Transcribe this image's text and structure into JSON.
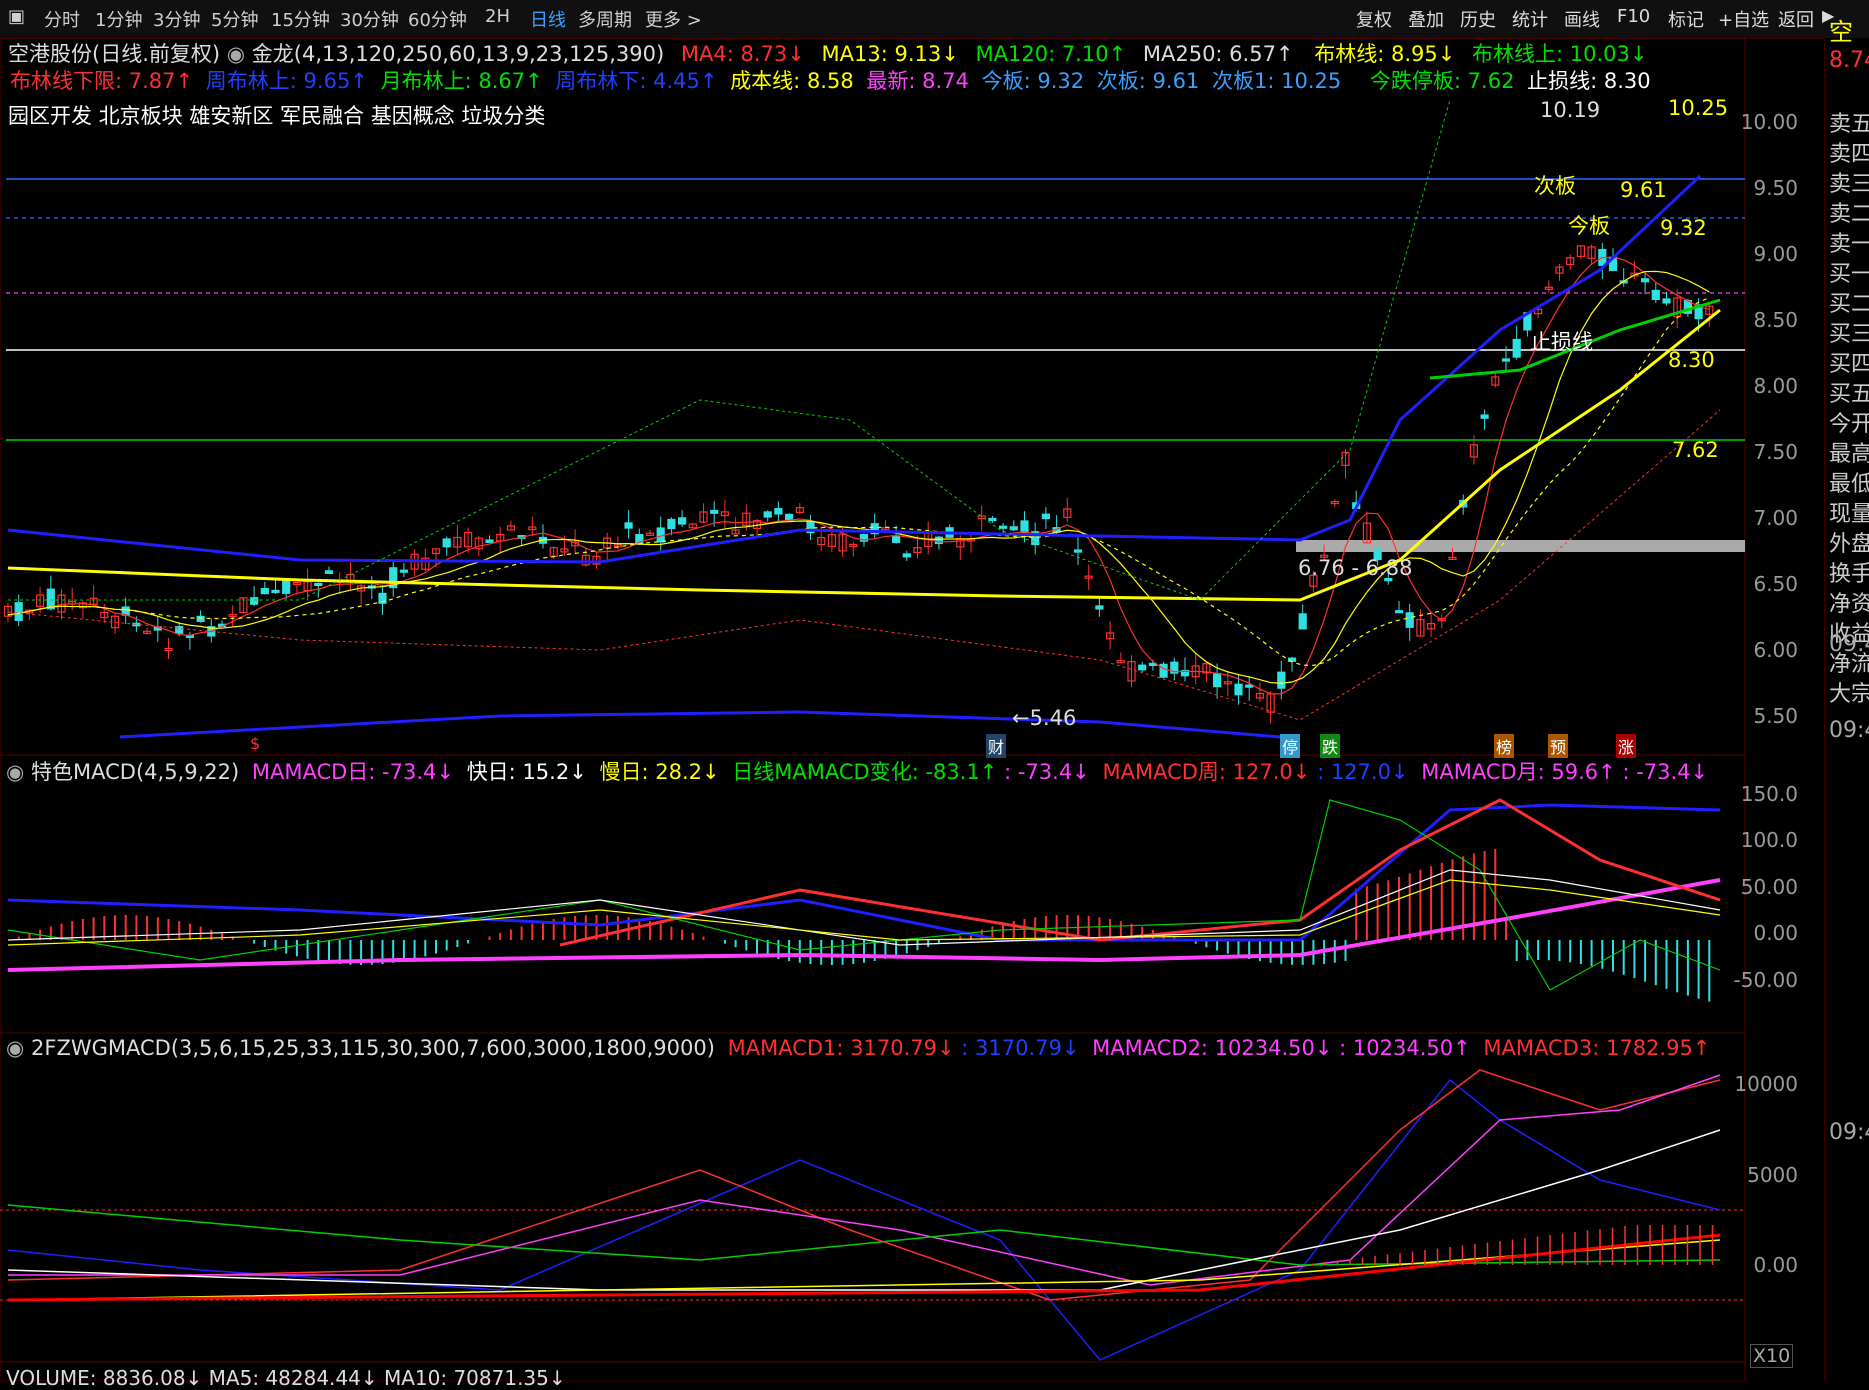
{
  "toolbar": {
    "periods": [
      "分时",
      "1分钟",
      "3分钟",
      "5分钟",
      "15分钟",
      "30分钟",
      "60分钟",
      "2H",
      "日线",
      "多周期",
      "更多 >"
    ],
    "active_period": "日线",
    "right_tools": [
      "复权",
      "叠加",
      "历史",
      "统计",
      "画线",
      "F10",
      "标记",
      "+自选",
      "返回"
    ]
  },
  "header": {
    "stock": "空港股份(日线.前复权)",
    "indicator": "金龙(4,13,120,250,60,13,9,23,125,390)",
    "ma4": "MA4: 8.73↓",
    "ma13": "MA13: 9.13↓",
    "ma120": "MA120: 7.10↑",
    "ma250": "MA250: 6.57↑",
    "boll": "布林线: 8.95↓",
    "boll_up": "布林线上: 10.03↓",
    "boll_low": "布林线下限: 7.87↑",
    "week_boll_up": "周布林上: 9.65↑",
    "month_boll_up": "月布林上: 8.67↑",
    "week_boll_low": "周布林下: 4.45↑",
    "cost": "成本线: 8.58",
    "latest": "最新: 8.74",
    "today_board": "今板: 9.32",
    "next_board": "次板: 9.61",
    "next_board1": "次板1: 10.25",
    "limit_down": "今跌停板: 7.62",
    "stop_loss": "止损线: 8.30",
    "concepts": "园区开发 北京板块  雄安新区 军民融合 基因概念 垃圾分类"
  },
  "right_price": "8.74",
  "right_title": "空",
  "price_axis": [
    "10.00",
    "9.50",
    "9.00",
    "8.50",
    "8.00",
    "7.50",
    "7.00",
    "6.50",
    "6.00",
    "5.50"
  ],
  "chart_labels": {
    "top_left_val": "10.19",
    "top_right_val": "10.25",
    "next_board_lbl": "次板",
    "next_board_val": "9.61",
    "today_board_lbl": "今板",
    "today_board_val": "9.32",
    "stop_loss_lbl": "止损线",
    "stop_loss_val": "8.30",
    "limit_down_val": "7.62",
    "gap_range": "6.76 - 6.88",
    "low_mark": "←5.46"
  },
  "markers": [
    "$",
    "财",
    "停",
    "跌",
    "榜",
    "预",
    "涨"
  ],
  "macd_panel": {
    "title": "特色MACD(4,5,9,22)",
    "mamacd_day": "MAMACD日: -73.4↓",
    "fast": "快日: 15.2↓",
    "slow": "慢日: 28.2↓",
    "change": "日线MAMACD变化: -83.1↑",
    "v1": ": -73.4↓",
    "week": "MAMACD周: 127.0↓",
    "v2": ": 127.0↓",
    "month": "MAMACD月: 59.6↑",
    "v3": ": -73.4↓",
    "axis": [
      "150.0",
      "100.0",
      "50.00",
      "0.00",
      "-50.00"
    ]
  },
  "macd2_panel": {
    "title": "2FZWGMACD(3,5,6,15,25,33,115,30,300,7,600,3000,1800,9000)",
    "m1": "MAMACD1: 3170.79↓",
    "v1": ": 3170.79↓",
    "m2": "MAMACD2: 10234.50↓",
    "v2": ": 10234.50↑",
    "m3": "MAMACD3: 1782.95↑",
    "axis": [
      "10000",
      "5000",
      "0.00"
    ],
    "scale": "X10"
  },
  "volume_line": "VOLUME: 8836.08↓  MA5: 48284.44↓  MA10: 70871.35↓",
  "sidebar": {
    "items": [
      "卖五",
      "卖四",
      "卖三",
      "卖二",
      "卖一",
      "买一",
      "买二",
      "买三",
      "买四",
      "买五",
      "今开",
      "最高",
      "最低",
      "现量",
      "外盘",
      "换手",
      "净资",
      "收益",
      "净流",
      "大宗"
    ],
    "times": [
      "09:4",
      "09:4",
      "09:4"
    ]
  },
  "colors": {
    "up": "#ff3030",
    "down": "#30e0e0",
    "ma_yellow": "#ffff00",
    "blue_line": "#2020ff",
    "green": "#00d000",
    "magenta": "#ff00ff"
  }
}
